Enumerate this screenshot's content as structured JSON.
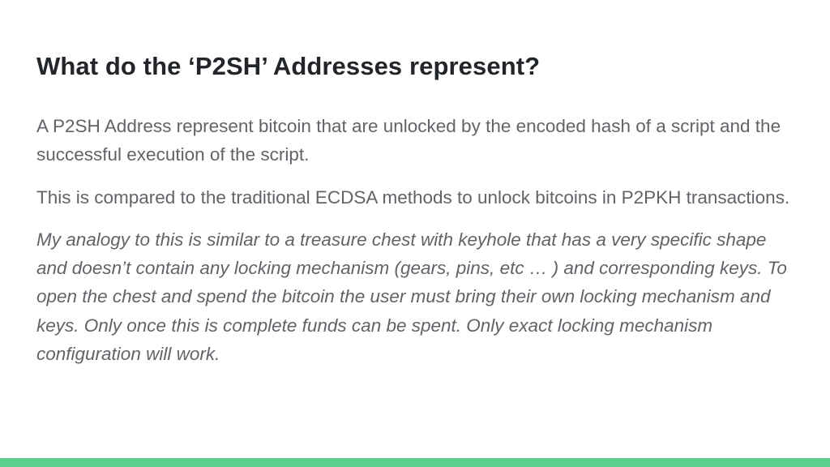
{
  "slide": {
    "title": "What do the ‘P2SH’ Addresses represent?",
    "paragraphs": [
      "A P2SH Address represent bitcoin that are unlocked by the encoded hash of a script and the successful execution of the script.",
      "This is compared to the traditional ECDSA methods to unlock bitcoins in P2PKH transactions.",
      "My analogy to this is similar to a treasure chest with keyhole that has a very specific shape and doesn’t contain any locking mechanism (gears, pins, etc … ) and corresponding keys. To open the chest and spend the bitcoin the user must bring their own locking mechanism and keys. Only once this is complete funds can be spent. Only exact locking mechanism configuration will work."
    ]
  },
  "colors": {
    "title": "#22252a",
    "body": "#606468",
    "accent_bar": "#5ccf8f",
    "background": "#ffffff"
  }
}
